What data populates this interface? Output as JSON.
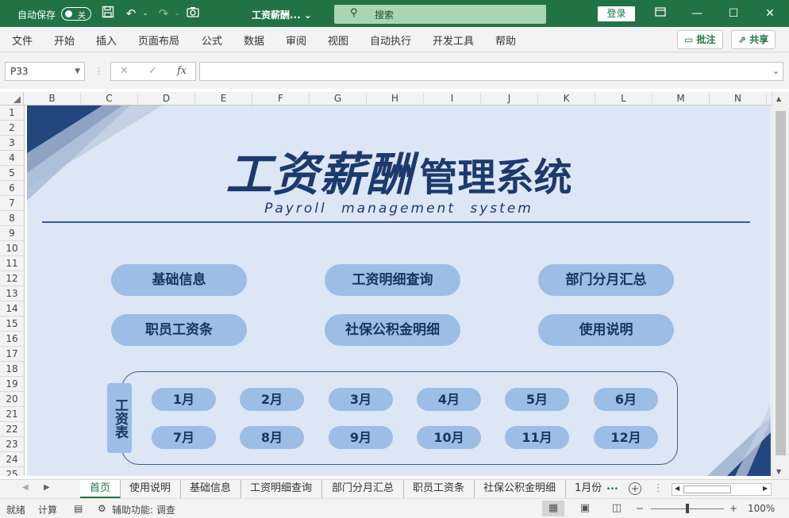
{
  "titlebar": {
    "autosave_label": "自动保存",
    "autosave_state": "关",
    "doc_title": "工资薪酬... ⌄",
    "search_placeholder": "搜索",
    "login_label": "登录"
  },
  "menu": {
    "items": [
      "文件",
      "开始",
      "插入",
      "页面布局",
      "公式",
      "数据",
      "审阅",
      "视图",
      "自动执行",
      "开发工具",
      "帮助"
    ],
    "comments_label": "批注",
    "share_label": "共享"
  },
  "formula_bar": {
    "name_box": "P33",
    "fx_label": "fx",
    "formula_value": ""
  },
  "grid": {
    "columns": [
      "B",
      "C",
      "D",
      "E",
      "F",
      "G",
      "H",
      "I",
      "J",
      "K",
      "L",
      "M",
      "N"
    ],
    "rows": [
      "1",
      "2",
      "3",
      "4",
      "5",
      "6",
      "7",
      "8",
      "9",
      "10",
      "11",
      "12",
      "13",
      "14",
      "15",
      "16",
      "17",
      "18",
      "19",
      "20",
      "21",
      "22",
      "23",
      "24",
      "25"
    ]
  },
  "dashboard": {
    "title_italic": "工资薪酬",
    "title_regular": "管理系统",
    "subtitle": "Payroll management system",
    "nav_buttons": [
      "基础信息",
      "工资明细查询",
      "部门分月汇总",
      "职员工资条",
      "社保公积金明细",
      "使用说明"
    ],
    "payroll_label": "工资表",
    "months": [
      "1月",
      "2月",
      "3月",
      "4月",
      "5月",
      "6月",
      "7月",
      "8月",
      "9月",
      "10月",
      "11月",
      "12月"
    ],
    "colors": {
      "canvas": "#dde6f4",
      "button": "#9bbde6",
      "text": "#1c3a6c",
      "deco_dark": "#23467f",
      "deco_light": "#a9bad6"
    }
  },
  "sheet_tabs": {
    "tabs": [
      "首页",
      "使用说明",
      "基础信息",
      "工资明细查询",
      "部门分月汇总",
      "职员工资条",
      "社保公积金明细",
      "1月份"
    ],
    "active": "首页",
    "more": "..."
  },
  "statusbar": {
    "ready": "就绪",
    "calc": "计算",
    "accessibility": "辅助功能: 调查",
    "zoom_minus": "−",
    "zoom_plus": "+",
    "zoom_level": "100%"
  },
  "theme": {
    "excel_green": "#217346"
  }
}
